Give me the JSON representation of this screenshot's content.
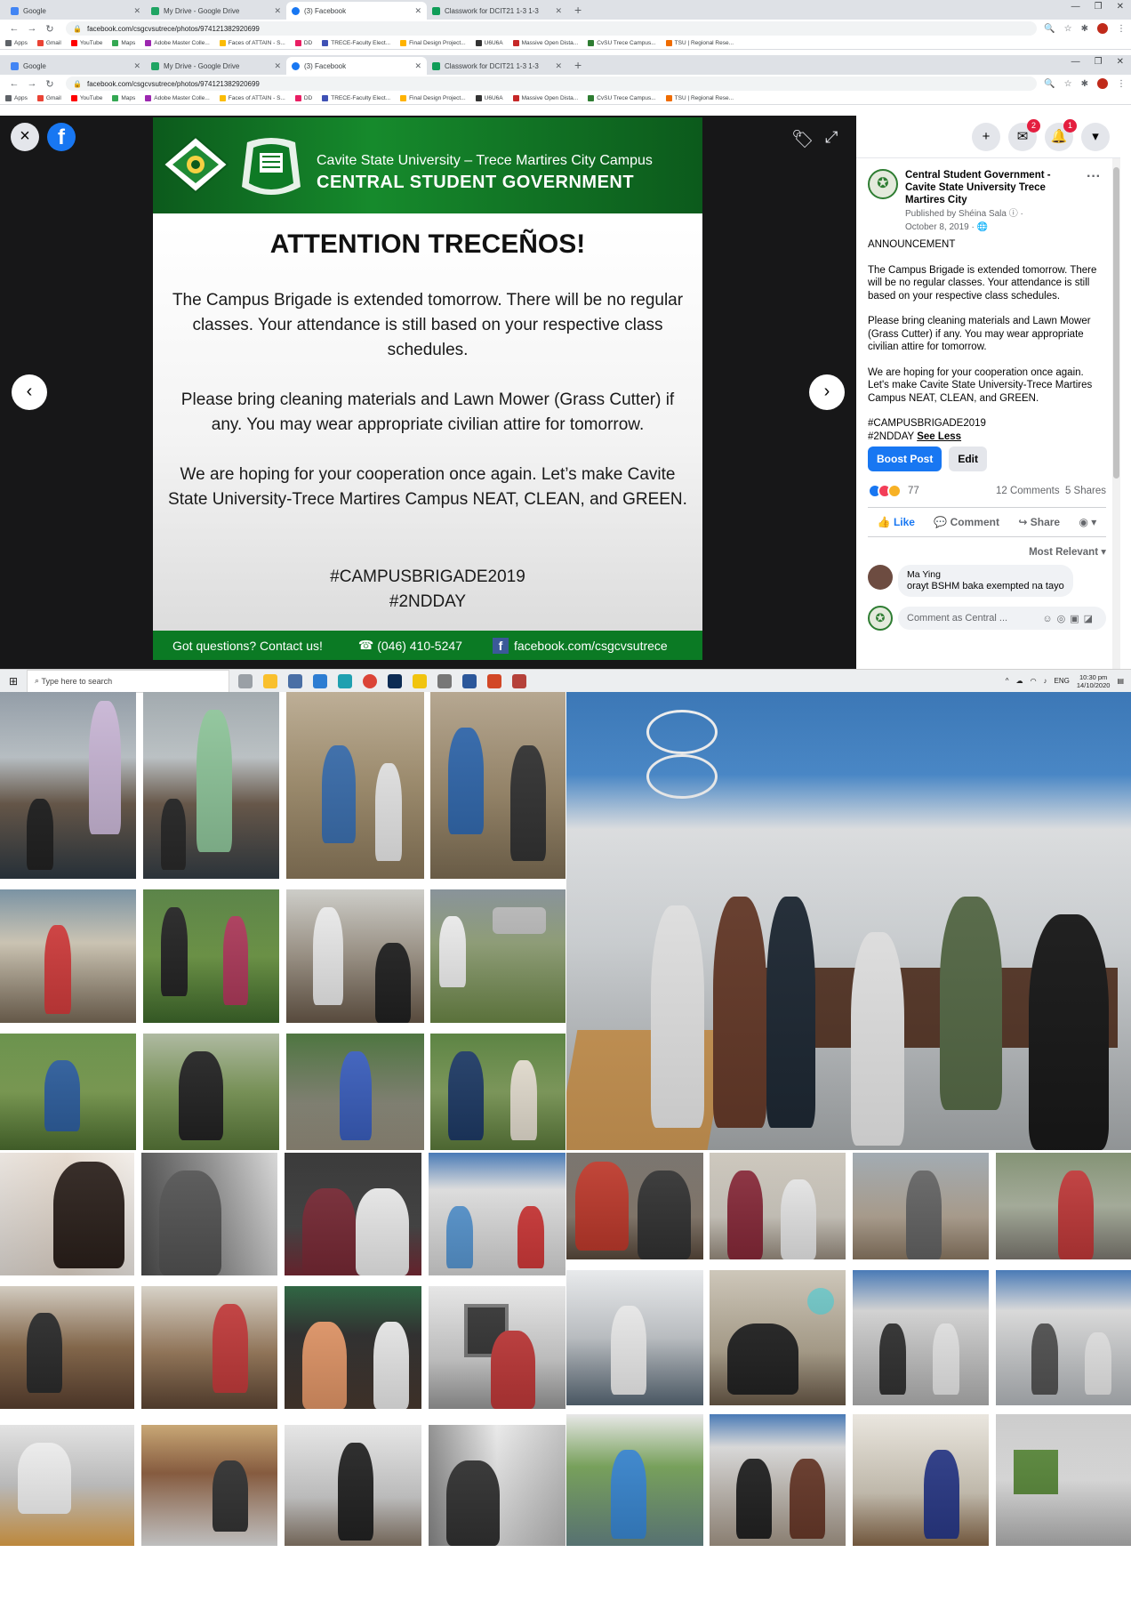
{
  "browser_top": {
    "tabs": [
      {
        "title": "Google",
        "color": "#4285f4"
      },
      {
        "title": "My Drive - Google Drive",
        "color": "#1fa463"
      },
      {
        "title": "(3) Facebook",
        "color": "#1877f2"
      },
      {
        "title": "Classwork for DCIT21 1-3 1-3",
        "color": "#0f9d58"
      }
    ],
    "url": "facebook.com/csgcvsutrece/photos/974121382920699",
    "bookmarks": [
      {
        "label": "Apps",
        "color": "#5f6368"
      },
      {
        "label": "Gmail",
        "color": "#ea4335"
      },
      {
        "label": "YouTube",
        "color": "#ff0000"
      },
      {
        "label": "Maps",
        "color": "#34a853"
      },
      {
        "label": "Adobe Master Colle...",
        "color": "#9c27b0"
      },
      {
        "label": "Faces of ATTAIN - S...",
        "color": "#fbbc05"
      },
      {
        "label": "DD",
        "color": "#e91e63"
      },
      {
        "label": "TRECE-Faculty Elect...",
        "color": "#3f51b5"
      },
      {
        "label": "Final Design Project...",
        "color": "#ffb300"
      },
      {
        "label": "U6U6A",
        "color": "#333333"
      },
      {
        "label": "Massive Open Dista...",
        "color": "#c62828"
      },
      {
        "label": "CvSU Trece Campus...",
        "color": "#2e7d32"
      },
      {
        "label": "TSU | Regional Rese...",
        "color": "#ef6c00"
      }
    ]
  },
  "browser_main": {
    "tabs": [
      {
        "title": "Google",
        "color": "#4285f4"
      },
      {
        "title": "My Drive - Google Drive",
        "color": "#1fa463"
      },
      {
        "title": "(3) Facebook",
        "color": "#1877f2"
      },
      {
        "title": "Classwork for DCIT21 1-3 1-3",
        "color": "#0f9d58"
      }
    ],
    "url": "facebook.com/csgcvsutrece/photos/974121382920699",
    "bookmarks": [
      {
        "label": "Apps",
        "color": "#5f6368"
      },
      {
        "label": "Gmail",
        "color": "#ea4335"
      },
      {
        "label": "YouTube",
        "color": "#ff0000"
      },
      {
        "label": "Maps",
        "color": "#34a853"
      },
      {
        "label": "Adobe Master Colle...",
        "color": "#9c27b0"
      },
      {
        "label": "Faces of ATTAIN - S...",
        "color": "#fbbc05"
      },
      {
        "label": "DD",
        "color": "#e91e63"
      },
      {
        "label": "TRECE-Faculty Elect...",
        "color": "#3f51b5"
      },
      {
        "label": "Final Design Project...",
        "color": "#ffb300"
      },
      {
        "label": "U6U6A",
        "color": "#333333"
      },
      {
        "label": "Massive Open Dista...",
        "color": "#c62828"
      },
      {
        "label": "CvSU Trece Campus...",
        "color": "#2e7d32"
      },
      {
        "label": "TSU | Regional Rese...",
        "color": "#ef6c00"
      }
    ]
  },
  "viewer": {
    "close_icon": "×",
    "fb_logo": "f",
    "prev_icon": "‹",
    "next_icon": "›",
    "tag_icon": "🏷",
    "expand_icon": "⤢"
  },
  "poster": {
    "university": "Cavite State University – Trece Martires City Campus",
    "org": "CENTRAL STUDENT GOVERNMENT",
    "title": "ATTENTION TRECEÑOS!",
    "para1": "The Campus Brigade is extended tomorrow.  There will be no regular classes. Your attendance is still based on your respective class schedules.",
    "para2": "Please bring cleaning materials and Lawn Mower (Grass Cutter) if any. You may wear appropriate civilian attire for tomorrow.",
    "para3": "We are hoping for your cooperation once again. Let’s make Cavite State University-Trece Martires Campus NEAT, CLEAN, and GREEN.",
    "hashtag1": "#CAMPUSBRIGADE2019",
    "hashtag2": "#2NDDAY",
    "footer_question": "Got questions? Contact us!",
    "footer_phone": "(046) 410-5247",
    "footer_fb": "facebook.com/csgcvsutrece",
    "accent_green": "#0b7a24"
  },
  "header_actions": {
    "messenger_badge": "2",
    "notif_badge": "1"
  },
  "post": {
    "page_name": "Central Student Government - Cavite State University Trece Martires City",
    "published_by": "Published by Shéina Sala",
    "date": "October 8, 2019",
    "body_title": "ANNOUNCEMENT",
    "body_p1": "The Campus Brigade is extended tomorrow. There will be no regular classes. Your attendance is still based on your respective class schedules.",
    "body_p2": "Please bring cleaning materials and Lawn Mower (Grass Cutter) if any. You may wear appropriate civilian attire for tomorrow.",
    "body_p3": "We are hoping for your cooperation once again. Let's make Cavite State University-Trece Martires Campus NEAT, CLEAN, and GREEN.",
    "hashtag1": "#CAMPUSBRIGADE2019",
    "hashtag2": "#2NDDAY",
    "see_less": "See Less",
    "boost_label": "Boost Post",
    "edit_label": "Edit",
    "reaction_count": "77",
    "comments_count": "12 Comments",
    "shares_count": "5 Shares",
    "like_label": "Like",
    "comment_label": "Comment",
    "share_label": "Share",
    "sort_label": "Most Relevant",
    "comment_author": "Ma Ying",
    "comment_text": "orayt BSHM baka exempted na tayo",
    "comment_placeholder": "Comment as Central ..."
  },
  "taskbar": {
    "search_placeholder": "Type here to search",
    "language": "ENG",
    "time": "10:30 pm",
    "date": "14/10/2020"
  }
}
